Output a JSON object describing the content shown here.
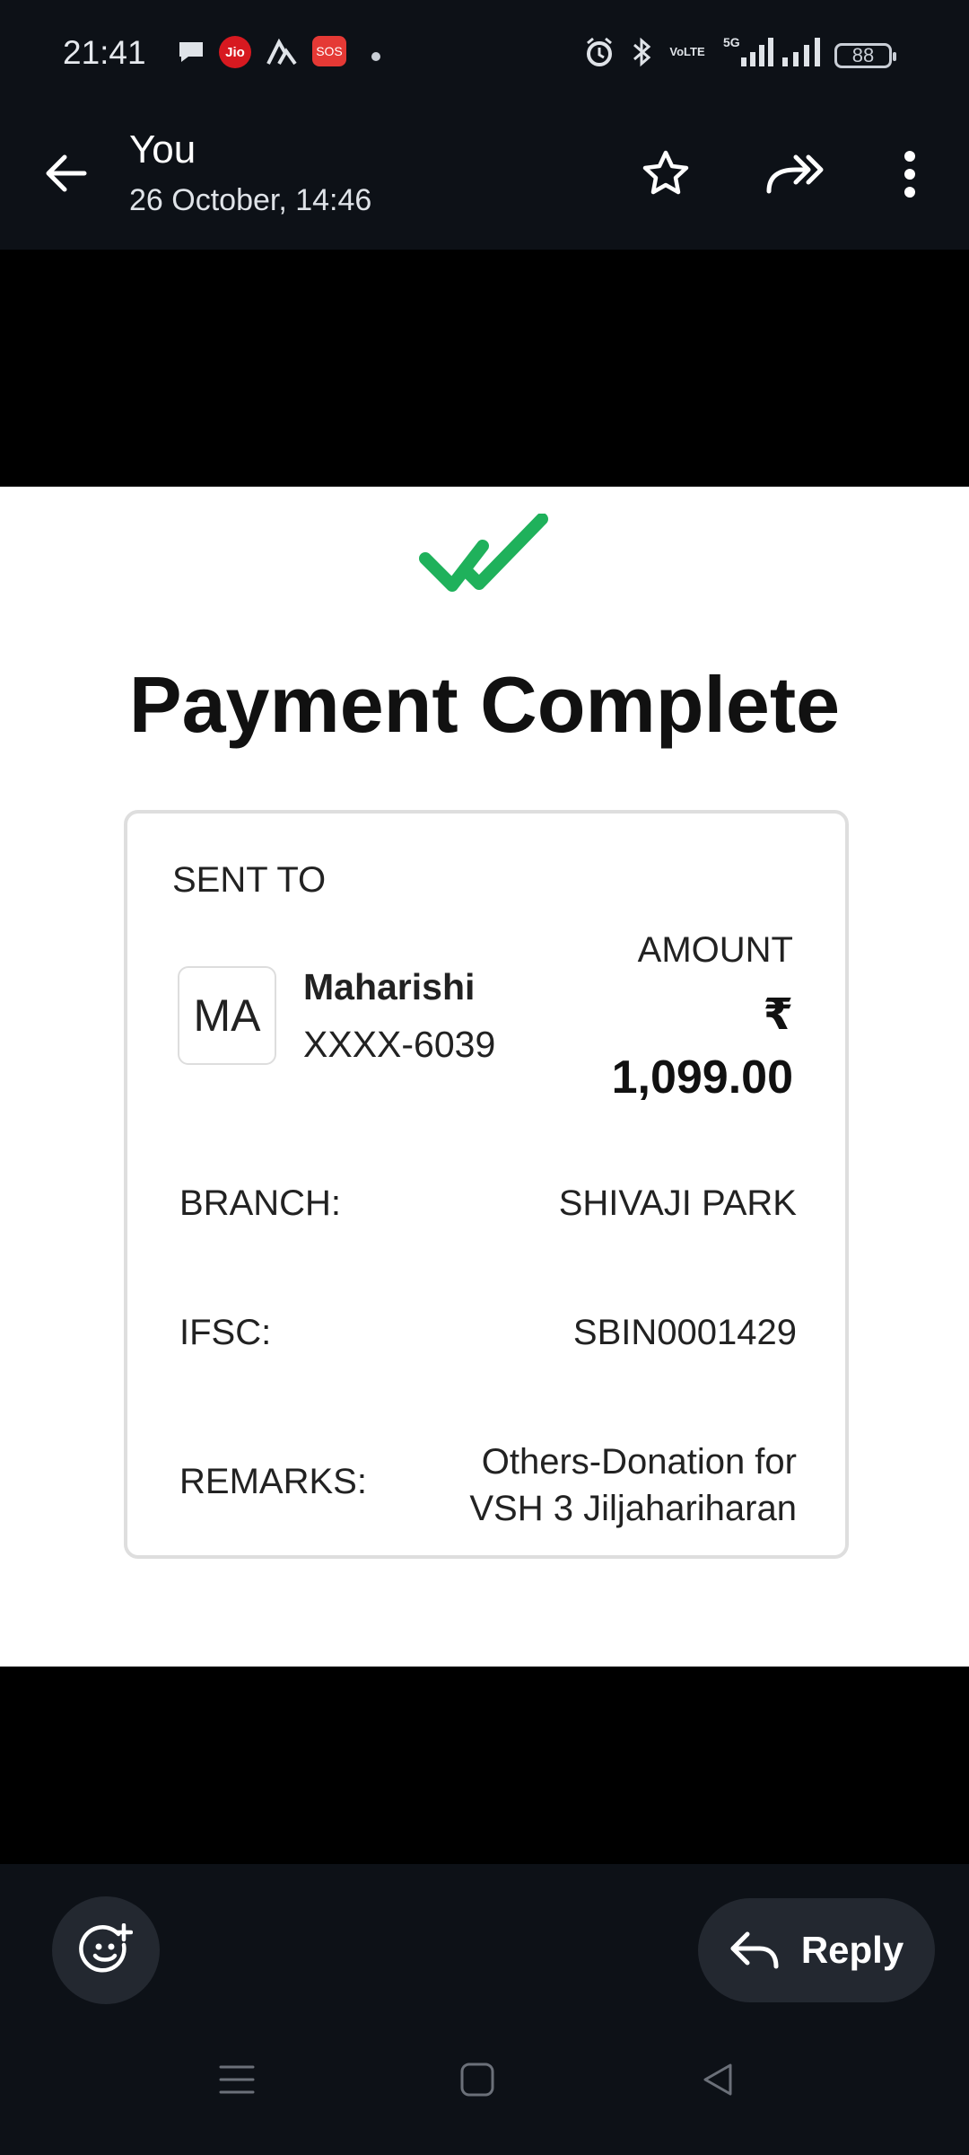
{
  "status_bar": {
    "time": "21:41",
    "jio_label": "Jio",
    "sos_label": "SOS",
    "network_label": "5G",
    "volte_label": "VoLTE",
    "battery": "88",
    "icons": [
      "chat-icon",
      "jio-icon",
      "app-icon",
      "sos-icon",
      "dot-icon",
      "alarm-icon",
      "bluetooth-icon",
      "volte-icon",
      "signal-icon",
      "signal-icon",
      "battery-icon"
    ]
  },
  "app_bar": {
    "sender": "You",
    "date": "26 October, 14:46",
    "icons": [
      "back-arrow-icon",
      "star-icon",
      "forward-icon",
      "more-vert-icon"
    ]
  },
  "receipt": {
    "title": "Payment Complete",
    "sent_to_label": "SENT TO",
    "avatar_initials": "MA",
    "payee_name": "Maharishi",
    "payee_account": "XXXX-6039",
    "amount_label": "AMOUNT",
    "currency_symbol": "₹",
    "amount": "1,099.00",
    "rows": [
      {
        "label": "BRANCH:",
        "value": "SHIVAJI PARK"
      },
      {
        "label": "IFSC:",
        "value": "SBIN0001429"
      },
      {
        "label": "REMARKS:",
        "value_line1": "Others-Donation for",
        "value_line2": "VSH 3 Jiljahariharan"
      }
    ],
    "accent_color": "#1fb15b"
  },
  "bottom_bar": {
    "reply_label": "Reply",
    "icons": [
      "emoji-add-icon",
      "reply-icon",
      "menu-icon",
      "home-icon",
      "back-icon"
    ]
  }
}
